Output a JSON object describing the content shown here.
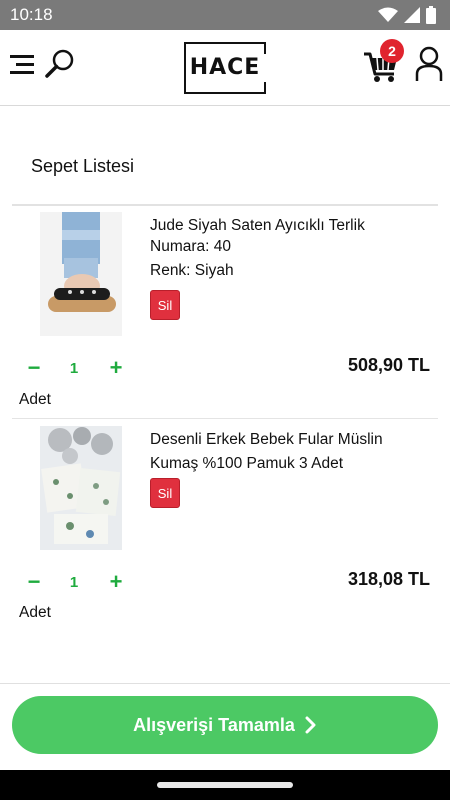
{
  "status_bar": {
    "time": "10:18"
  },
  "header": {
    "logo_text": "HACE",
    "cart_count": "2"
  },
  "page": {
    "title": "Sepet Listesi"
  },
  "cart": {
    "items": [
      {
        "title": "Jude Siyah Saten Ayıcıklı Terlik",
        "attributes": [
          "Numara: 40",
          "Renk: Siyah"
        ],
        "remove_label": "Sil",
        "quantity": "1",
        "minus_label": "−",
        "plus_label": "+",
        "unit": "Adet",
        "price": "508,90 TL"
      },
      {
        "title": "Desenli Erkek Bebek Fular Müslin Kumaş %100 Pamuk 3 Adet",
        "attributes": [],
        "remove_label": "Sil",
        "quantity": "1",
        "minus_label": "−",
        "plus_label": "+",
        "unit": "Adet",
        "price": "318,08 TL"
      }
    ]
  },
  "checkout": {
    "label": "Alışverişi Tamamla"
  },
  "colors": {
    "accent_green": "#4cc964",
    "qty_green": "#1fab3e",
    "remove_red": "#e0303e",
    "badge_red": "#e0242e"
  },
  "icons": [
    "wifi-icon",
    "signal-icon",
    "battery-icon",
    "menu-icon",
    "search-icon",
    "cart-icon",
    "user-icon",
    "chevron-right-icon"
  ]
}
